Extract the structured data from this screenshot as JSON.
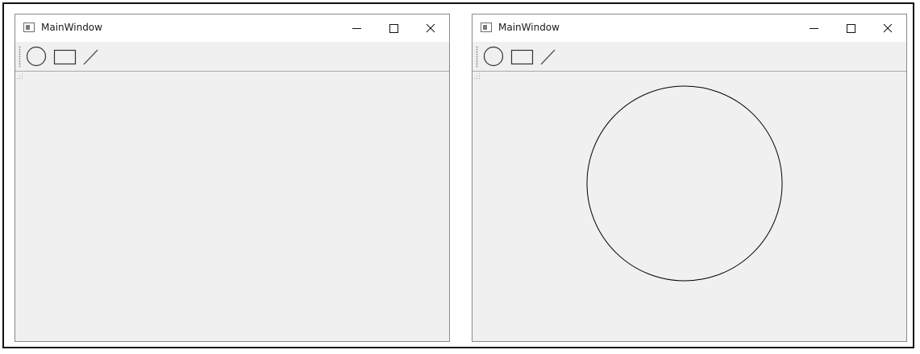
{
  "windows": [
    {
      "title": "MainWindow",
      "canvas_state": "empty",
      "toolbar": {
        "tools": [
          {
            "icon": "circle-icon"
          },
          {
            "icon": "rectangle-icon"
          },
          {
            "icon": "line-icon"
          }
        ]
      },
      "caption_buttons": [
        "minimize-icon",
        "maximize-icon",
        "close-icon"
      ]
    },
    {
      "title": "MainWindow",
      "canvas_state": "circle drawn",
      "toolbar": {
        "tools": [
          {
            "icon": "circle-icon"
          },
          {
            "icon": "rectangle-icon"
          },
          {
            "icon": "line-icon"
          }
        ]
      },
      "caption_buttons": [
        "minimize-icon",
        "maximize-icon",
        "close-icon"
      ]
    }
  ],
  "colors": {
    "window_bg": "#f0f0f0",
    "titlebar_bg": "#ffffff",
    "stroke": "#000000"
  }
}
